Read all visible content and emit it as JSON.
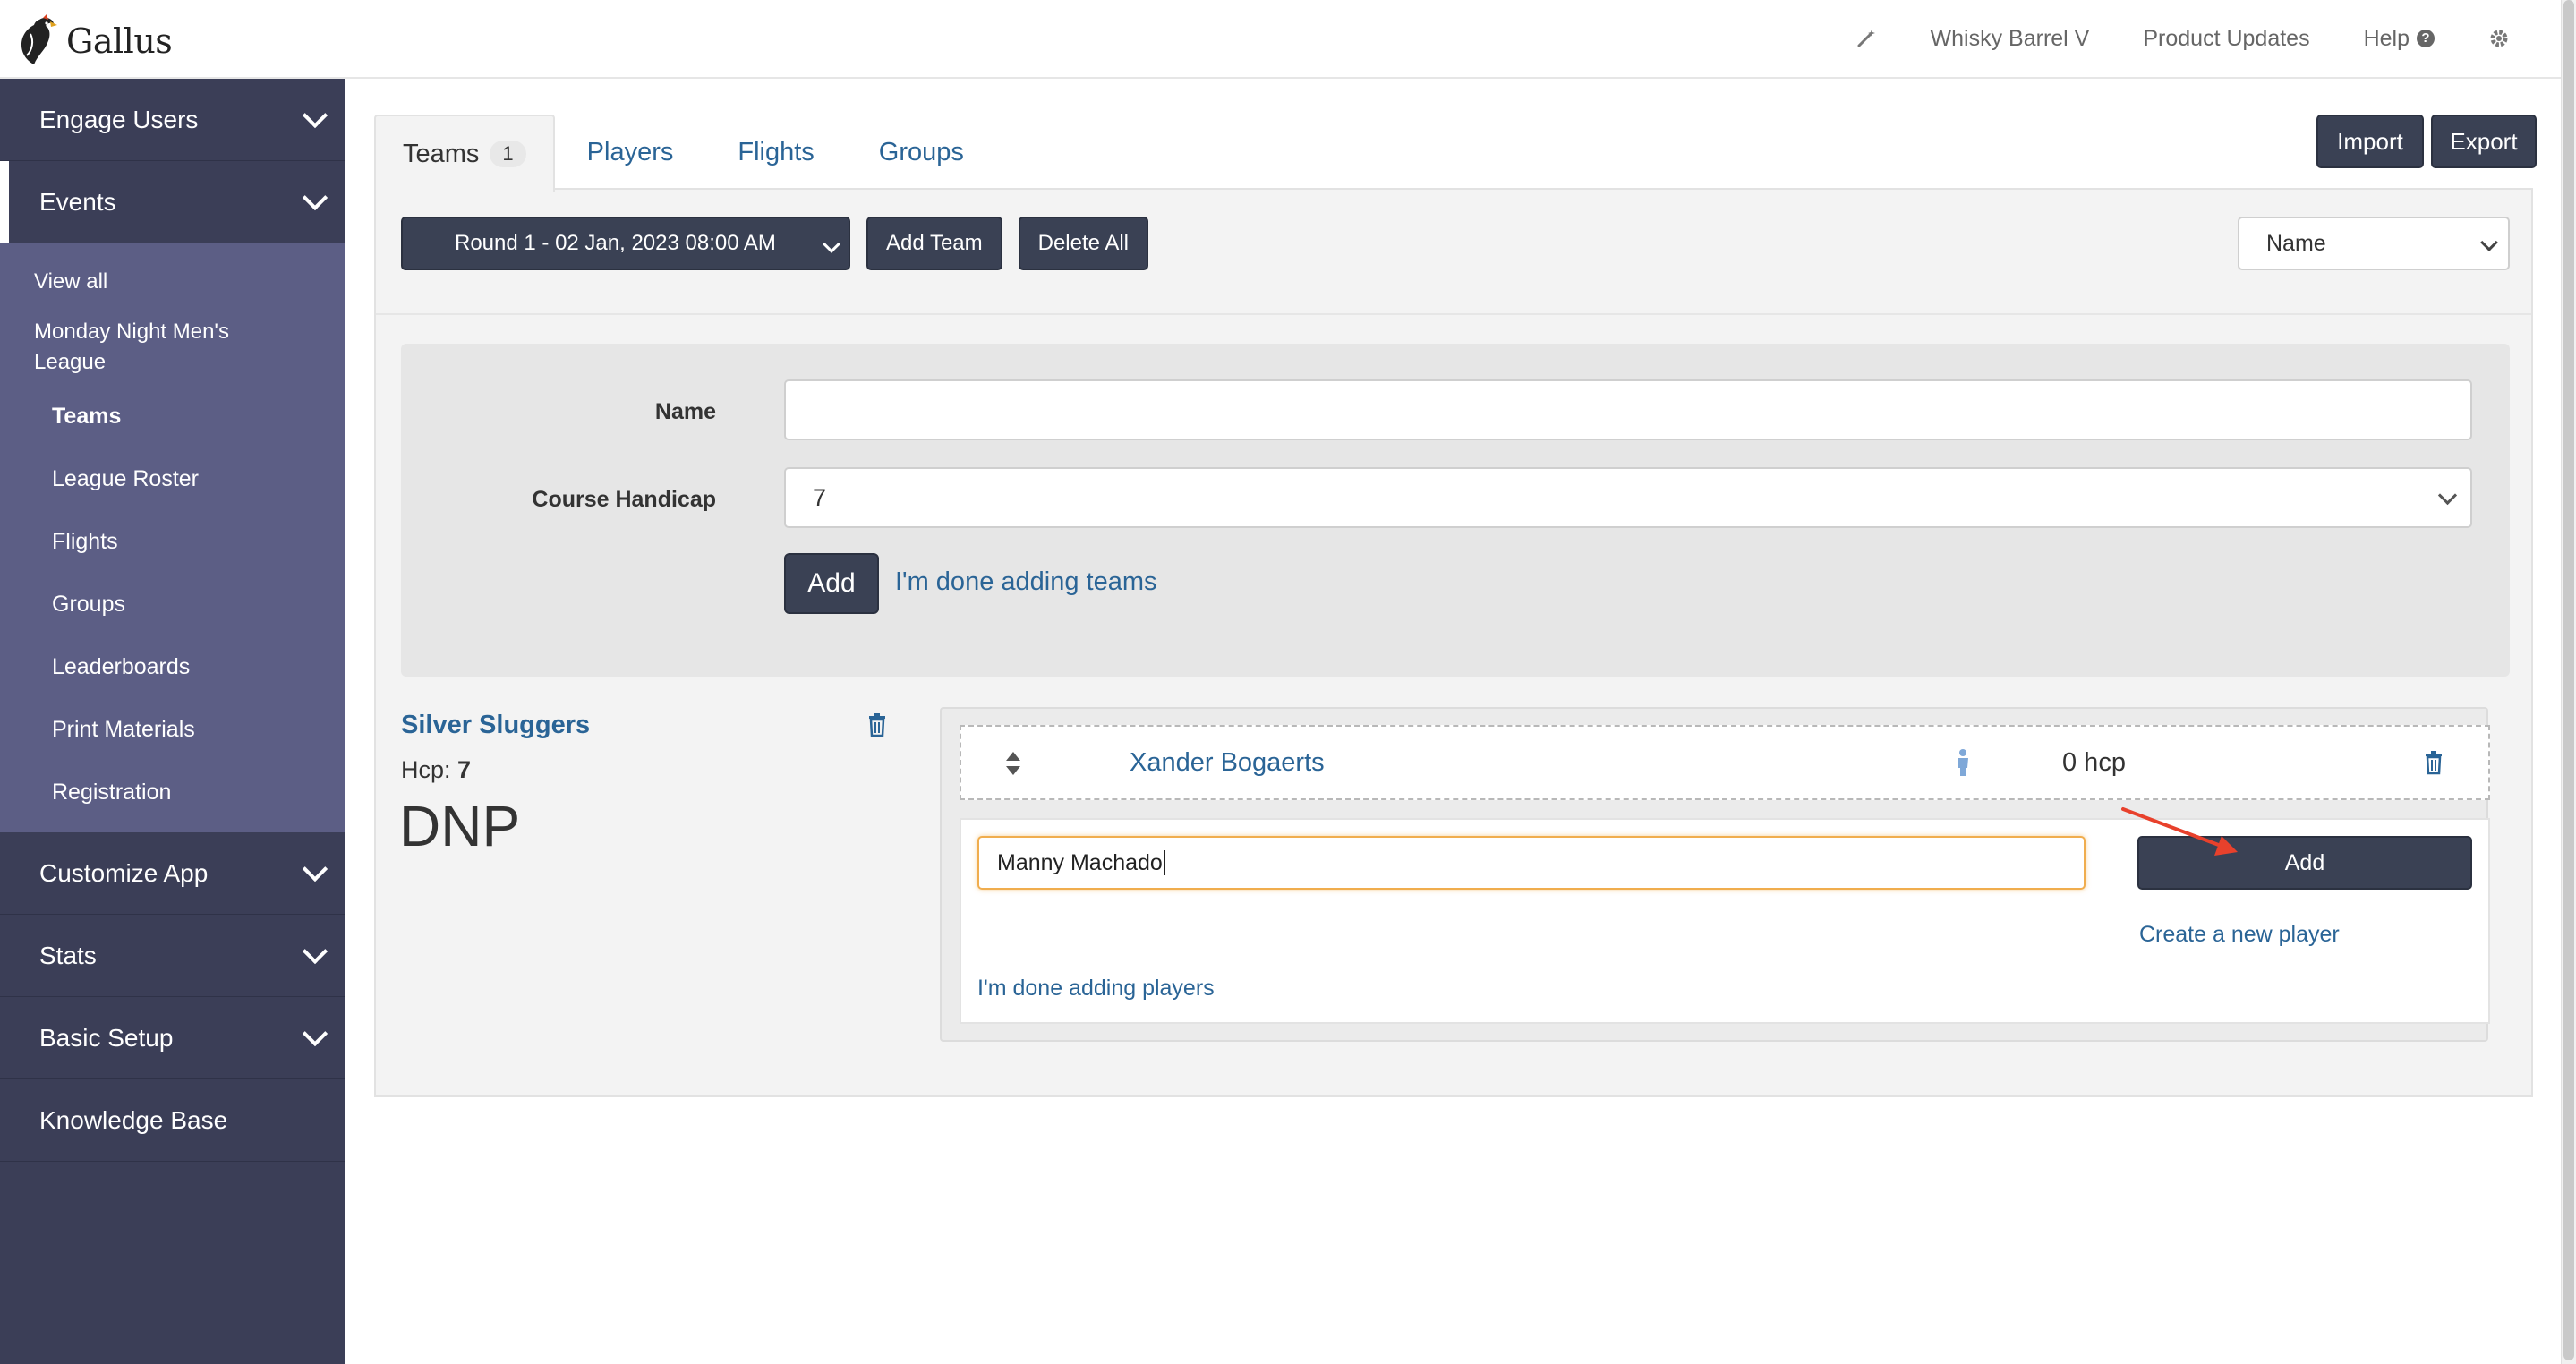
{
  "app": {
    "name": "Gallus"
  },
  "topnav": {
    "wand_icon": "magic-wand-icon",
    "club": "Whisky Barrel V",
    "product_updates": "Product Updates",
    "help": "Help",
    "help_icon": "?",
    "settings_icon": "gear-icon"
  },
  "sidebar": {
    "engage_users": "Engage Users",
    "events": "Events",
    "events_sub": {
      "view_all": "View all",
      "league": "Monday Night Men's League",
      "children": [
        "Teams",
        "League Roster",
        "Flights",
        "Groups",
        "Leaderboards",
        "Print Materials",
        "Registration"
      ]
    },
    "customize_app": "Customize App",
    "stats": "Stats",
    "basic_setup": "Basic Setup",
    "knowledge_base": "Knowledge Base"
  },
  "tabs": [
    {
      "label": "Teams",
      "count": "1"
    },
    {
      "label": "Players"
    },
    {
      "label": "Flights"
    },
    {
      "label": "Groups"
    }
  ],
  "header_buttons": {
    "import": "Import",
    "export": "Export"
  },
  "toolbar": {
    "round": "Round 1 - 02 Jan, 2023 08:00 AM",
    "add_team": "Add Team",
    "delete_all": "Delete All",
    "sort_by": "Name"
  },
  "team_form": {
    "name_label": "Name",
    "name_value": "",
    "handicap_label": "Course Handicap",
    "handicap_value": "7",
    "add_button": "Add",
    "done_link": "I'm done adding teams"
  },
  "team": {
    "name": "Silver Sluggers",
    "hcp_label": "Hcp:",
    "hcp_value": "7",
    "status": "DNP",
    "players": [
      {
        "name": "Xander Bogaerts",
        "hcp": "0 hcp"
      }
    ],
    "add_player": {
      "input_value": "Manny Machado",
      "add_button": "Add",
      "create_link": "Create a new player",
      "done_link": "I'm done adding players"
    }
  },
  "colors": {
    "sidebar_bg": "#3b3e57",
    "sidebar_sub_bg": "#5c5e85",
    "button_dark": "#3a4154",
    "link_blue": "#2a6496",
    "input_focus": "#f0ad4e",
    "annotation_arrow": "#e8412c"
  }
}
